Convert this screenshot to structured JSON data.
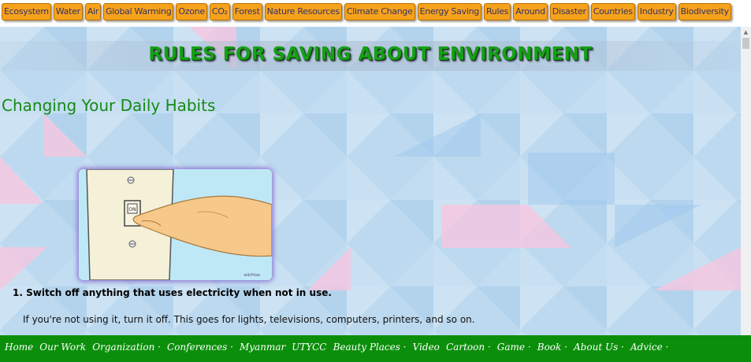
{
  "top_nav": {
    "items": [
      "Ecosystem",
      "Water",
      "Air",
      "Global Warming",
      "Ozone",
      "CO₂",
      "Forest",
      "Nature Resources",
      "Climate Change",
      "Energy Saving",
      "Rules",
      "Around",
      "Disaster",
      "Countries",
      "Industry",
      "Biodiversity"
    ]
  },
  "banner": {
    "title": "RULES FOR SAVING ABOUT ENVIRONMENT"
  },
  "section": {
    "heading": "Changing Your Daily Habits"
  },
  "step": {
    "number": "1.",
    "title": "Switch off anything that uses electricity when not in use.",
    "body": "If you're not using it, turn it off. This goes for lights, televisions, computers, printers, and so on.",
    "image_watermark": "wikiHow",
    "switch_label": "ON"
  },
  "bottom_nav": {
    "items": [
      "Home",
      "Our Work",
      "Organization ·",
      "Conferences ·",
      "Myanmar",
      "UTYCC",
      "Beauty Places ·",
      "Video",
      "Cartoon ·",
      "Game ·",
      "Book ·",
      "About Us ·",
      "Advice ·"
    ]
  },
  "colors": {
    "tab_orange": "#f7a21b",
    "heading_green": "#168a16",
    "footer_green": "#0b8f0b"
  }
}
